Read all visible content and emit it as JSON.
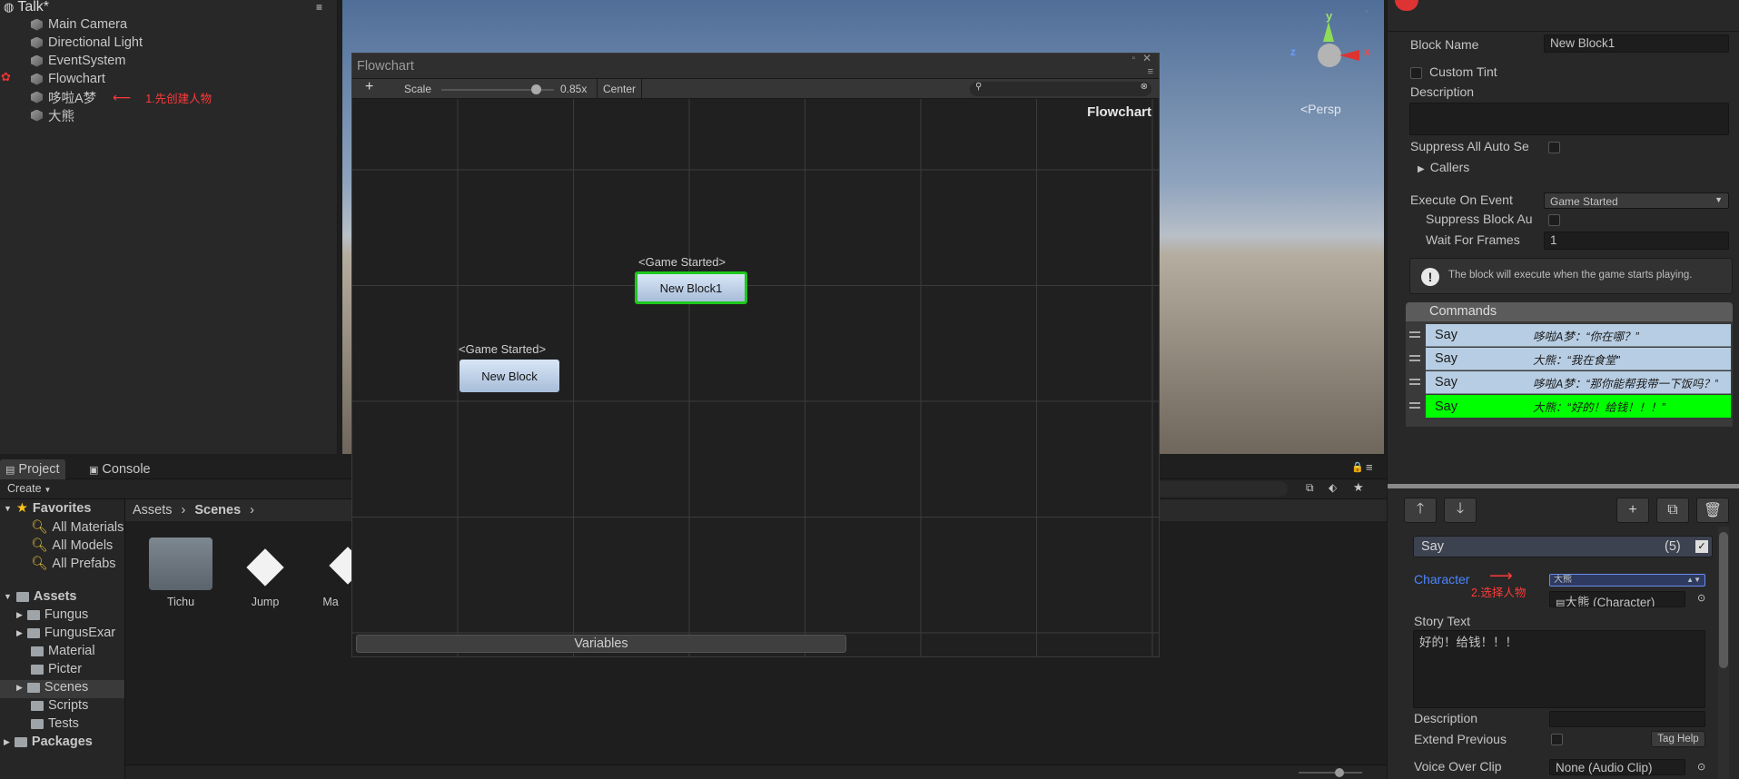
{
  "hierarchy": {
    "scene_name": "Talk*",
    "items": [
      "Main Camera",
      "Directional Light",
      "EventSystem",
      "Flowchart",
      "哆啦A梦",
      "大熊"
    ],
    "annotation": "1.先创建人物"
  },
  "scene_view": {
    "persp_label": "<Persp",
    "axis_y": "y",
    "axis_x": "x",
    "axis_z": "z"
  },
  "flowchart_window": {
    "title": "Flowchart",
    "add_label": "+",
    "scale_label": "Scale",
    "scale_value": "0.85x",
    "scale_fraction": 0.85,
    "center_label": "Center",
    "canvas_title": "Flowchart",
    "blocks": [
      {
        "event": "<Game Started>",
        "name": "New Block1",
        "selected": true
      },
      {
        "event": "<Game Started>",
        "name": "New Block",
        "selected": false
      }
    ],
    "variables_label": "Variables"
  },
  "project": {
    "tabs": [
      "Project",
      "Console"
    ],
    "create_label": "Create",
    "favorites_label": "Favorites",
    "favorites": [
      "All Materials",
      "All Models",
      "All Prefabs"
    ],
    "assets_label": "Assets",
    "assets": [
      "Fungus",
      "FungusExar",
      "Material",
      "Picter",
      "Scenes",
      "Scripts",
      "Tests"
    ],
    "packages_label": "Packages",
    "breadcrumb": [
      "Assets",
      "Scenes"
    ],
    "items": [
      "Tichu",
      "Jump",
      "Ma"
    ]
  },
  "inspector": {
    "block_name_label": "Block Name",
    "block_name_value": "New Block1",
    "custom_tint_label": "Custom Tint",
    "description_label": "Description",
    "suppress_all_label": "Suppress All Auto Se",
    "callers_label": "Callers",
    "execute_on_event_label": "Execute On Event",
    "execute_on_event_value": "Game Started",
    "suppress_block_label": "Suppress Block Au",
    "wait_for_frames_label": "Wait For Frames",
    "wait_for_frames_value": "1",
    "info_text": "The block will execute when the game starts playing.",
    "commands_label": "Commands",
    "commands": [
      {
        "name": "Say",
        "text": "哆啦A梦：“你在哪？”"
      },
      {
        "name": "Say",
        "text": "大熊：“我在食堂”"
      },
      {
        "name": "Say",
        "text": "哆啦A梦：“那你能帮我带一下饭吗？”"
      },
      {
        "name": "Say",
        "text": "大熊：“好的！给钱！！！”"
      }
    ],
    "say_header": "Say",
    "say_index": "(5)",
    "character_label": "Character",
    "character_dropdown": "大熊",
    "character_annotation": "2.选择人物",
    "character_object": "大熊 (Character)",
    "story_text_label": "Story Text",
    "story_text_value": "好的！给钱！！！",
    "description2_label": "Description",
    "extend_previous_label": "Extend Previous",
    "tag_help_label": "Tag Help",
    "voice_over_label": "Voice Over Clip",
    "voice_over_value": "None (Audio Clip)",
    "colors": {
      "command_row": "#b7cde3",
      "selected_command": "#00ff00",
      "annotation": "#ff3a3a",
      "character_label": "#4a86ff"
    }
  }
}
